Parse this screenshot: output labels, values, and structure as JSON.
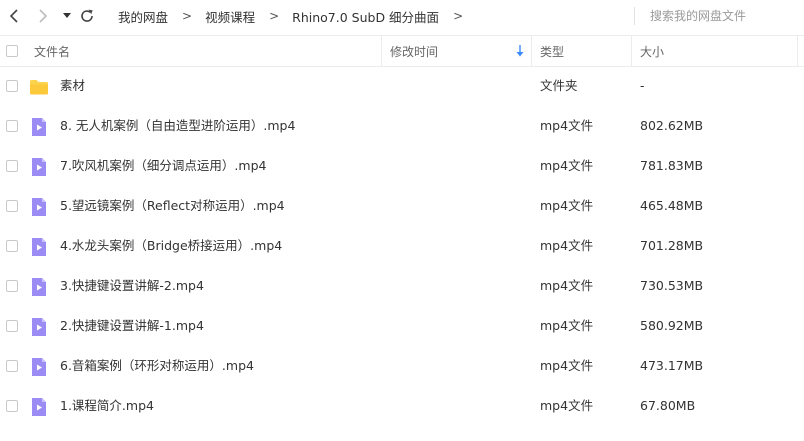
{
  "nav": {
    "back_icon": "chevron-left-icon",
    "forward_icon": "chevron-right-icon",
    "history_icon": "caret-down-icon",
    "refresh_icon": "refresh-icon",
    "breadcrumb": [
      "我的网盘",
      "视频课程",
      "Rhino7.0 SubD 细分曲面"
    ],
    "breadcrumb_separator": ">",
    "search_placeholder": "搜索我的网盘文件"
  },
  "table": {
    "columns": {
      "name": "文件名",
      "modified": "修改时间",
      "type": "类型",
      "size": "大小"
    },
    "sort_icon": "arrow-down-icon",
    "sort_color": "#3b8cff",
    "rows": [
      {
        "name": "素材",
        "type": "文件夹",
        "size": "-",
        "icon": "folder-icon",
        "icon_color": "#fcd34d"
      },
      {
        "name": "8. 无人机案例（自由造型进阶运用）.mp4",
        "type": "mp4文件",
        "size": "802.62MB",
        "icon": "video-file-icon",
        "icon_color": "#9b8cf5"
      },
      {
        "name": "7.吹风机案例（细分调点运用）.mp4",
        "type": "mp4文件",
        "size": "781.83MB",
        "icon": "video-file-icon",
        "icon_color": "#9b8cf5"
      },
      {
        "name": "5.望远镜案例（Reflect对称运用）.mp4",
        "type": "mp4文件",
        "size": "465.48MB",
        "icon": "video-file-icon",
        "icon_color": "#9b8cf5"
      },
      {
        "name": "4.水龙头案例（Bridge桥接运用）.mp4",
        "type": "mp4文件",
        "size": "701.28MB",
        "icon": "video-file-icon",
        "icon_color": "#9b8cf5"
      },
      {
        "name": "3.快捷键设置讲解-2.mp4",
        "type": "mp4文件",
        "size": "730.53MB",
        "icon": "video-file-icon",
        "icon_color": "#9b8cf5"
      },
      {
        "name": "2.快捷键设置讲解-1.mp4",
        "type": "mp4文件",
        "size": "580.92MB",
        "icon": "video-file-icon",
        "icon_color": "#9b8cf5"
      },
      {
        "name": "6.音箱案例（环形对称运用）.mp4",
        "type": "mp4文件",
        "size": "473.17MB",
        "icon": "video-file-icon",
        "icon_color": "#9b8cf5"
      },
      {
        "name": "1.课程简介.mp4",
        "type": "mp4文件",
        "size": "67.80MB",
        "icon": "video-file-icon",
        "icon_color": "#9b8cf5"
      }
    ]
  }
}
